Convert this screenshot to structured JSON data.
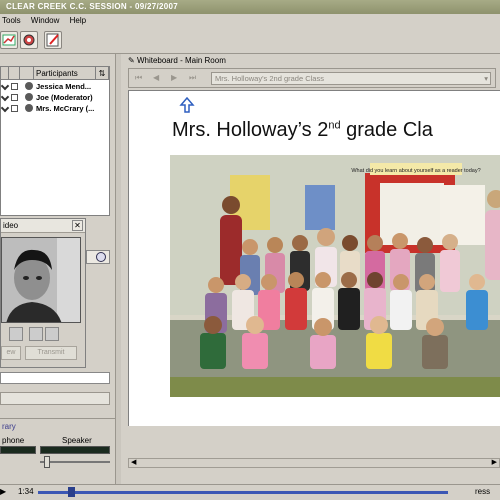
{
  "window": {
    "title": "CLEAR CREEK C.C. SESSION - 09/27/2007"
  },
  "menu": {
    "items": [
      "Tools",
      "Window",
      "Help"
    ]
  },
  "participants": {
    "header": "Participants",
    "rows": [
      {
        "name": "Jessica Mend..."
      },
      {
        "name": "Joe (Moderator)"
      },
      {
        "name": "Mrs. McCrary (..."
      }
    ]
  },
  "webcam": {
    "title": "ideo",
    "button_left": "ew",
    "button_right": "Transmit"
  },
  "audio": {
    "section": "rary",
    "microphone": "phone",
    "speaker": "Speaker"
  },
  "whiteboard": {
    "tab": "Whiteboard - Main Room",
    "page_select": "Mrs. Holloway's 2nd grade Class",
    "slide_title_main": "Mrs. Holloway’s 2",
    "slide_title_sup": "nd",
    "slide_title_rest": " grade Cla",
    "banner": "What did you learn about yourself as a reader today?"
  },
  "playback": {
    "time": "1:34",
    "right_label": "ress"
  },
  "colors": {
    "titlebar": "#9a9e7a",
    "seek": "#3c57b4",
    "whiteboard_bg": "#ffffff"
  }
}
